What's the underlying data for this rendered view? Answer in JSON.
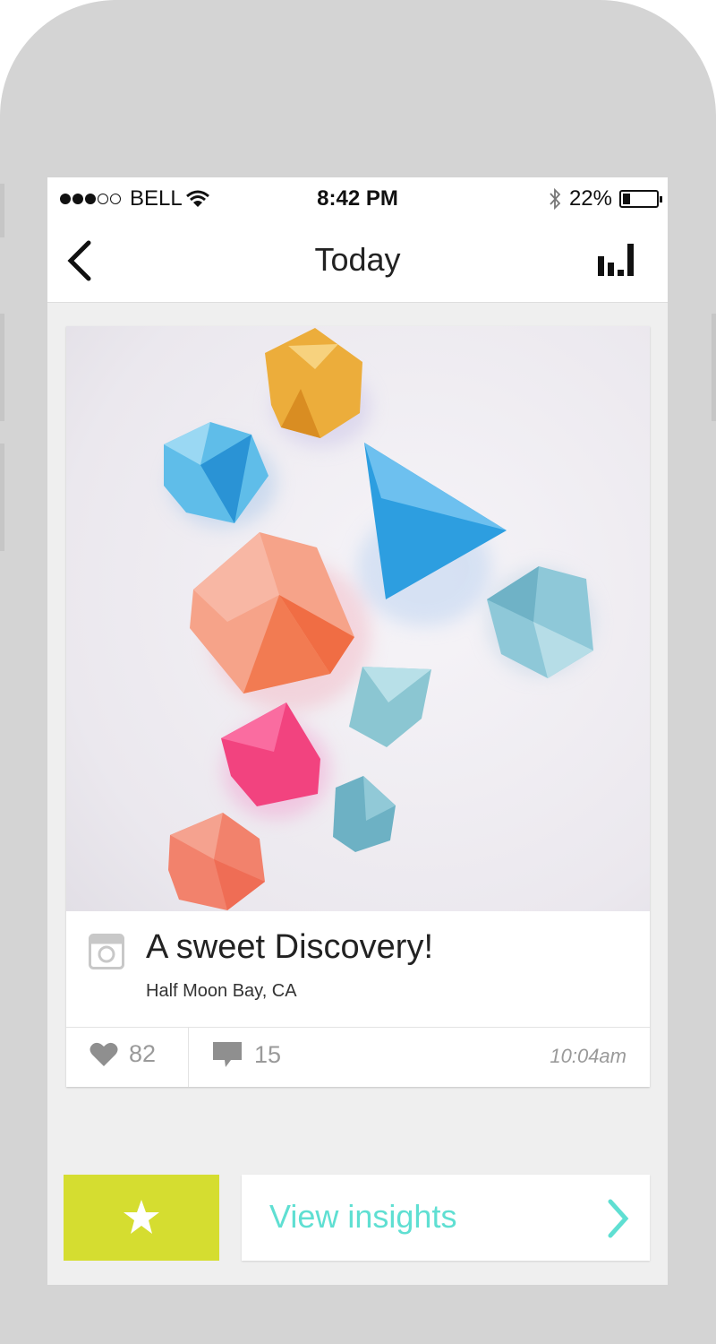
{
  "status_bar": {
    "carrier": "BELL",
    "time": "8:42 PM",
    "battery": "22%",
    "battery_level": 0.22,
    "signal_bars": 3,
    "signal_max": 5
  },
  "nav": {
    "title": "Today",
    "back_icon": "chevron-left-icon",
    "right_icon": "bar-chart-icon"
  },
  "post": {
    "title": "A sweet Discovery!",
    "location": "Half Moon Bay, CA",
    "likes": "82",
    "comments": "15",
    "time": "10:04am",
    "source_icon": "instagram-icon"
  },
  "actions": {
    "favorite_icon": "star-icon",
    "insights_label": "View insights",
    "insights_icon": "chevron-right-icon"
  },
  "colors": {
    "accent_lime": "#d5dd30",
    "accent_teal": "#5fdfd2"
  }
}
